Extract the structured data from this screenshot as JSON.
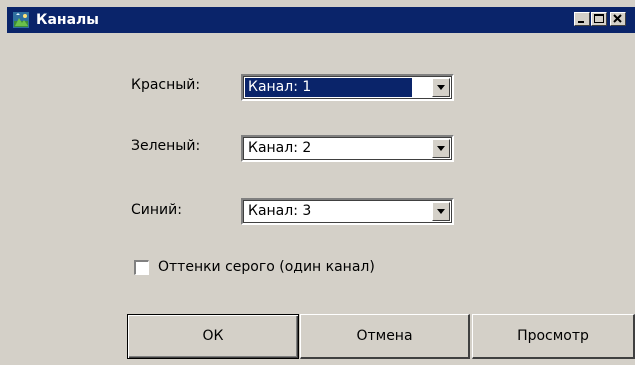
{
  "window": {
    "title": "Каналы",
    "colors": {
      "titlebar": "#0a246a",
      "face": "#d4d0c8",
      "selection": "#0a246a"
    }
  },
  "caption_buttons": [
    "minimize-icon",
    "maximize-icon",
    "close-icon"
  ],
  "channels": {
    "red": {
      "label": "Красный:",
      "value": "Канал: 1",
      "selected": true
    },
    "green": {
      "label": "Зеленый:",
      "value": "Канал: 2",
      "selected": false
    },
    "blue": {
      "label": "Синий:",
      "value": "Канал: 3",
      "selected": false
    }
  },
  "grayscale": {
    "label": "Оттенки серого (один канал)",
    "checked": false
  },
  "buttons": {
    "ok": "ОК",
    "cancel": "Отмена",
    "preview": "Просмотр"
  }
}
